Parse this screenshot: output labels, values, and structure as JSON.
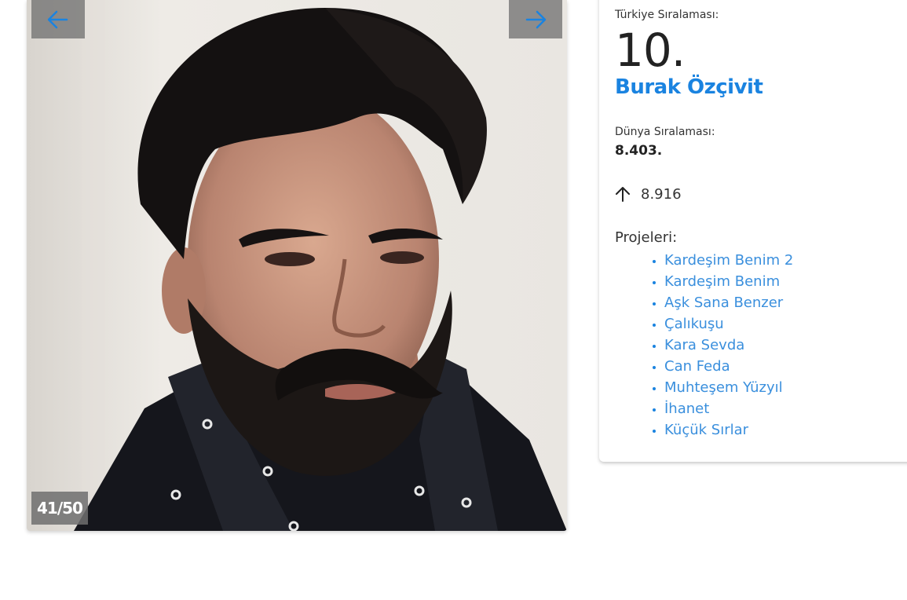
{
  "gallery": {
    "counter": "41/50",
    "prev_icon": "arrow-left-icon",
    "next_icon": "arrow-right-icon"
  },
  "ranking": {
    "turkey_label": "Türkiye Sıralaması:",
    "turkey_rank": "10.",
    "name": "Burak Özçivit",
    "world_label": "Dünya Sıralaması:",
    "world_rank": "8.403.",
    "trend_icon": "arrow-up-icon",
    "trend_value": "8.916"
  },
  "projects": {
    "label": "Projeleri:",
    "items": [
      "Kardeşim Benim 2",
      "Kardeşim Benim",
      "Aşk Sana Benzer",
      "Çalıkuşu",
      "Kara Sevda",
      "Can Feda",
      "Muhteşem Yüzyıl",
      "İhanet",
      "Küçük Sırlar"
    ]
  },
  "colors": {
    "accent": "#1a83e0",
    "overlay": "#6e6e6e"
  }
}
